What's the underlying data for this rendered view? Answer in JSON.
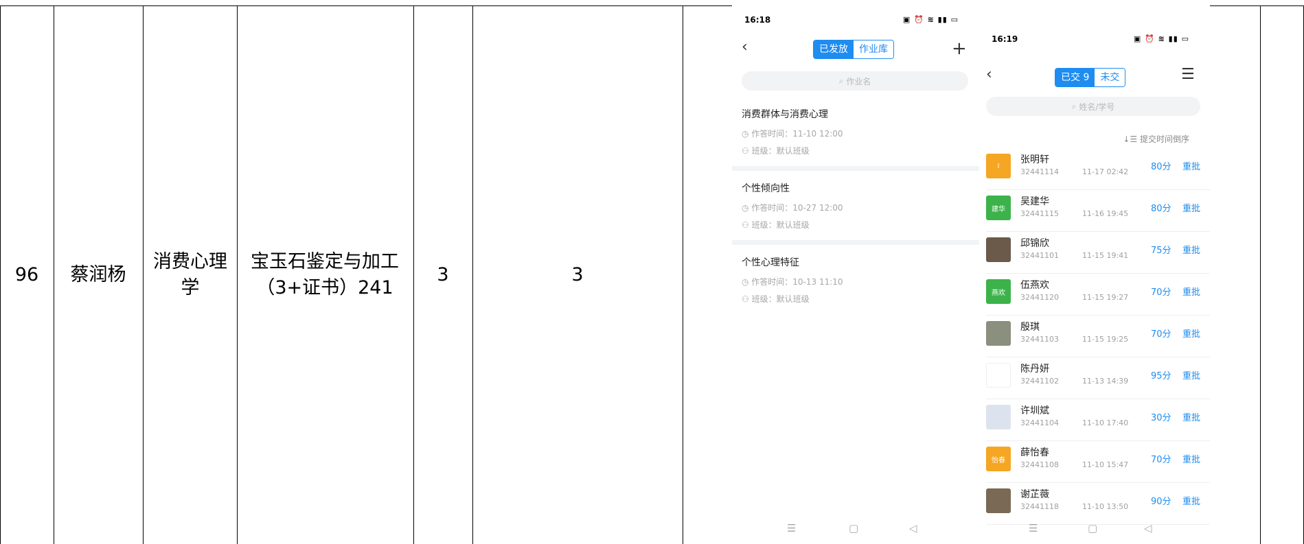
{
  "table": {
    "index": "96",
    "student": "蔡润杨",
    "course": "消费心理学",
    "class_name": "宝玉石鉴定与加工（3+证书）241",
    "count_a": "3",
    "count_b": "3"
  },
  "phone_left": {
    "time": "16:18",
    "status_icons": "▣ ⏰ ≋ ▮▮ ▭",
    "back_icon": "‹",
    "tabs": [
      "已发放",
      "作业库"
    ],
    "add_icon": "+",
    "search_placeholder": "作业名",
    "assignments": [
      {
        "title": "消费群体与消费心理",
        "time": "作答时间：11-10 12:00",
        "class": "班级：默认班级"
      },
      {
        "title": "个性倾向性",
        "time": "作答时间：10-27 12:00",
        "class": "班级：默认班级"
      },
      {
        "title": "个性心理特征",
        "time": "作答时间：10-13 11:10",
        "class": "班级：默认班级"
      }
    ],
    "nav": [
      "☰",
      "▢",
      "◁"
    ]
  },
  "phone_right": {
    "time": "16:19",
    "status_icons": "▣ ⏰ ≋ ▮▮ ▭",
    "back_icon": "‹",
    "tabs": [
      "已交 9",
      "未交"
    ],
    "menu_icon": "☰",
    "search_placeholder": "姓名/学号",
    "sort_label": "↓☰ 提交时间倒序",
    "submissions": [
      {
        "avatar_text": "I",
        "avatar_color": "#f5a623",
        "name": "张明轩",
        "id": "32441114",
        "time": "11-17 02:42",
        "score": "80分",
        "action": "重批"
      },
      {
        "avatar_text": "建华",
        "avatar_color": "#3cb34a",
        "name": "吴建华",
        "id": "32441115",
        "time": "11-16 19:45",
        "score": "80分",
        "action": "重批"
      },
      {
        "avatar_text": "",
        "avatar_color": "#6b5a4a",
        "name": "邱锦欣",
        "id": "32441101",
        "time": "11-15 19:41",
        "score": "75分",
        "action": "重批"
      },
      {
        "avatar_text": "燕欢",
        "avatar_color": "#3cb34a",
        "name": "伍燕欢",
        "id": "32441120",
        "time": "11-15 19:27",
        "score": "70分",
        "action": "重批"
      },
      {
        "avatar_text": "",
        "avatar_color": "#8a8f7e",
        "name": "殷琪",
        "id": "32441103",
        "time": "11-15 19:25",
        "score": "70分",
        "action": "重批"
      },
      {
        "avatar_text": "",
        "avatar_color": "#ffffff",
        "name": "陈丹妍",
        "id": "32441102",
        "time": "11-13 14:39",
        "score": "95分",
        "action": "重批"
      },
      {
        "avatar_text": "",
        "avatar_color": "#dde3ee",
        "name": "许圳斌",
        "id": "32441104",
        "time": "11-10 17:40",
        "score": "30分",
        "action": "重批"
      },
      {
        "avatar_text": "怡春",
        "avatar_color": "#f5a623",
        "name": "薛怡春",
        "id": "32441108",
        "time": "11-10 15:47",
        "score": "70分",
        "action": "重批"
      },
      {
        "avatar_text": "",
        "avatar_color": "#7a6a55",
        "name": "谢芷薇",
        "id": "32441118",
        "time": "11-10 13:50",
        "score": "90分",
        "action": "重批"
      }
    ],
    "nav": [
      "☰",
      "▢",
      "◁"
    ]
  }
}
